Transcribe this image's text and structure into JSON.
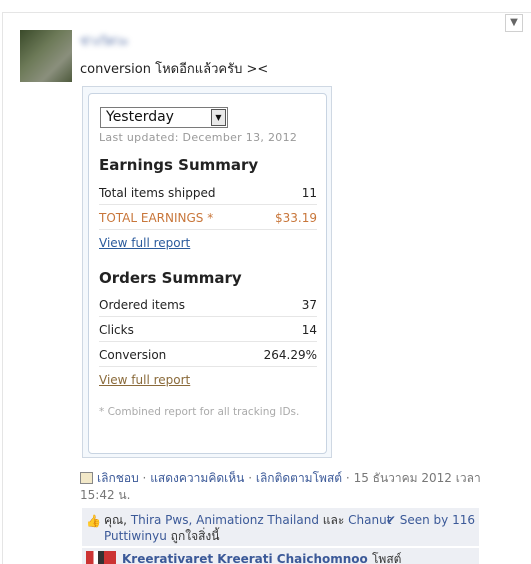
{
  "post": {
    "author": "ช่างวิศวะ",
    "text": "conversion โหดอีกแล้วครับ ><"
  },
  "report": {
    "period_select": "Yesterday",
    "last_updated": "Last updated: December 13, 2012",
    "earnings": {
      "heading": "Earnings Summary",
      "rows": [
        {
          "label": "Total items shipped",
          "value": "11"
        },
        {
          "label": "TOTAL EARNINGS *",
          "value": "$33.19"
        }
      ],
      "link": "View full report"
    },
    "orders": {
      "heading": "Orders Summary",
      "rows": [
        {
          "label": "Ordered items",
          "value": "37"
        },
        {
          "label": "Clicks",
          "value": "14"
        },
        {
          "label": "Conversion",
          "value": "264.29%"
        }
      ],
      "link": "View full report"
    },
    "footnote": "* Combined report for all tracking IDs."
  },
  "actions": {
    "unlike": "เลิกชอบ",
    "comment": "แสดงความคิดเห็น",
    "unfollow": "เลิกติดตามโพสต์",
    "sep": "·",
    "timestamp": "15 ธันวาคม 2012 เวลา 15:42 น."
  },
  "likes": {
    "you": "คุณ,",
    "person1": "Thira Pws,",
    "person2": "Animationz Thailand",
    "and": "และ",
    "person3": "Chanut Puttiwinyu",
    "suffix": "ถูกใจสิ่งนี้",
    "seen": "Seen by 116"
  },
  "comment": {
    "name": "Kreerativaret Kreerati Chaichomnoo",
    "text": "โพสต์"
  },
  "colors": {
    "link_blue": "#3b5998",
    "earnings_orange": "#c8763a",
    "like_bg": "#edeff4"
  }
}
